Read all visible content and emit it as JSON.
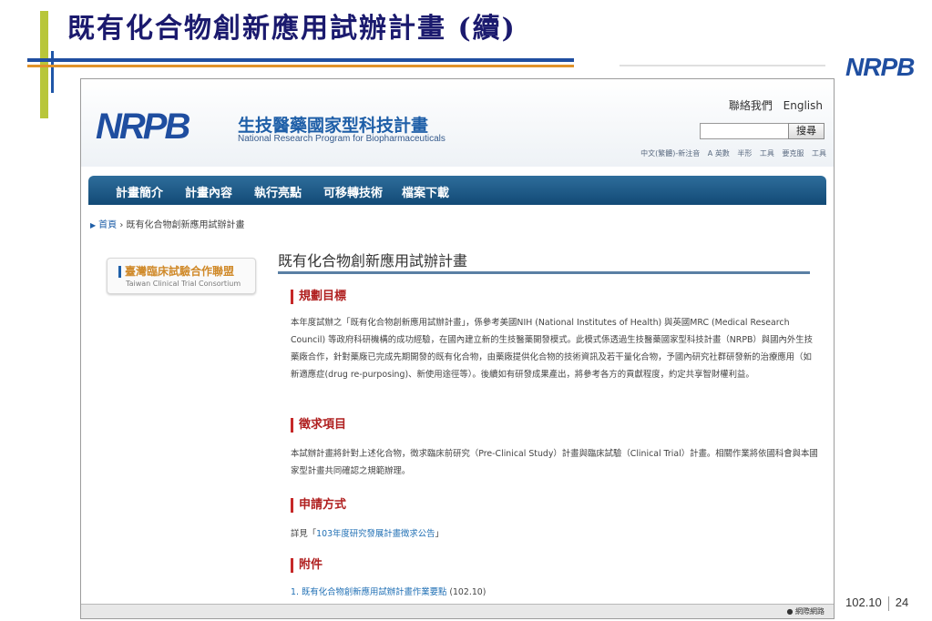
{
  "slide": {
    "title": "既有化合物創新應用試辦計畫 (續)",
    "corner_logo": "NRPB",
    "date": "102.10",
    "page_number": "24"
  },
  "site": {
    "logo_text": "NRPB",
    "name_zh": "生技醫藥國家型科技計畫",
    "name_en": "National Research Program for Biopharmaceuticals",
    "top_links": [
      "聯絡我們",
      "English"
    ],
    "search_button": "搜尋",
    "search_placeholder": "",
    "toolbar_items": [
      "中文(繁體)-新注音",
      "A 英數",
      "半形",
      "工具",
      "要克服",
      "工具"
    ]
  },
  "nav": {
    "items": [
      "計畫簡介",
      "計畫內容",
      "執行亮點",
      "可移轉技術",
      "檔案下載"
    ]
  },
  "breadcrumb": {
    "home": "首頁",
    "separator": "›",
    "current": "既有化合物創新應用試辦計畫"
  },
  "sidebar": {
    "card_zh": "臺灣臨床試驗合作聯盟",
    "card_en": "Taiwan Clinical Trial Consortium"
  },
  "main": {
    "title": "既有化合物創新應用試辦計畫",
    "sections": {
      "goal": {
        "heading": "規劃目標",
        "body": "本年度試辦之「既有化合物創新應用試辦計畫」，係參考美國NIH (National Institutes of Health) 與英國MRC (Medical Research Council) 等政府科研機構的成功經驗，在國內建立新的生技醫藥開發模式。此模式係透過生技醫藥國家型科技計畫（NRPB）與國內外生技藥廠合作，針對藥廠已完成先期開發的既有化合物，由藥廠提供化合物的技術資訊及若干量化合物，予國內研究社群研發新的治療應用（如新適應症(drug re-purposing)、新使用途徑等）。後續如有研發成果產出，將參考各方的貢獻程度，約定共享智財權利益。"
      },
      "call": {
        "heading": "徵求項目",
        "body": "本試辦計畫將針對上述化合物，徵求臨床前研究（Pre-Clinical Study）計畫與臨床試驗（Clinical Trial）計畫。相關作業將依國科會與本國家型計畫共同確認之規範辦理。"
      },
      "apply": {
        "heading": "申請方式",
        "prefix": "詳見「",
        "link": "103年度研究發展計畫徵求公告",
        "suffix": "」"
      },
      "attach": {
        "heading": "附件",
        "item_prefix": "1.",
        "link": "既有化合物創新應用試辦計畫作業要點",
        "suffix": "(102.10)"
      }
    }
  },
  "statusbar": {
    "zone": "網際網路"
  },
  "colors": {
    "title": "#1b1a6e",
    "nav_bg": "#124a76",
    "section_heading": "#b02020",
    "link": "#1f6fb4",
    "accent_green": "#b8c63a",
    "accent_orange": "#e0922a"
  }
}
